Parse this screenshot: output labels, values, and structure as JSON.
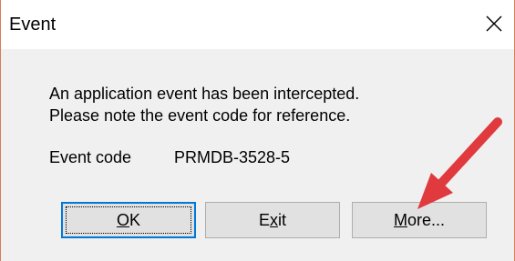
{
  "window": {
    "title": "Event",
    "close_icon": "close-icon"
  },
  "message": {
    "line1": "An application event has been intercepted.",
    "line2": "Please note the event code for reference."
  },
  "event_code": {
    "label": "Event code",
    "value": "PRMDB-3528-5"
  },
  "buttons": {
    "ok": {
      "label": "OK",
      "mnemonic": "O"
    },
    "exit": {
      "label": "Exit",
      "mnemonic": "x"
    },
    "more": {
      "label": "More...",
      "mnemonic": "M"
    }
  },
  "annotation": {
    "arrow_icon": "red-arrow-icon",
    "arrow_color": "#e0393e"
  }
}
